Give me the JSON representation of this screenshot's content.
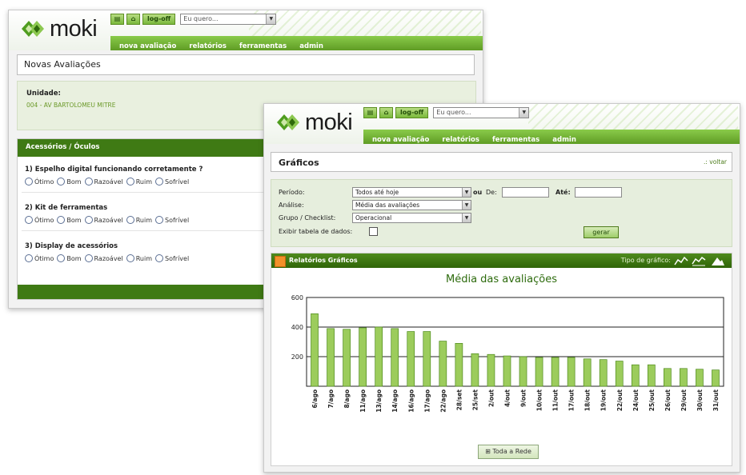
{
  "brand": {
    "logo_text": "moki",
    "green": "#6aa92f",
    "dark_green": "#3f7a14"
  },
  "window1": {
    "toolbar": {
      "logoff_label": "log-off",
      "search_select_value": "Eu quero..."
    },
    "nav": [
      "nova avaliação",
      "relatórios",
      "ferramentas",
      "admin"
    ],
    "page_title": "Novas Avaliações",
    "unit": {
      "label": "Unidade:",
      "value": "004 - AV BARTOLOMEU MITRE"
    },
    "section": {
      "title": "Acessórios / Óculos",
      "questions": [
        {
          "text": "1) Espelho digital funcionando corretamente ?"
        },
        {
          "text": "2) Kit de ferramentas"
        },
        {
          "text": "3) Display de acessórios"
        }
      ],
      "options": [
        "Ótimo",
        "Bom",
        "Razoável",
        "Ruim",
        "Sofrível"
      ]
    }
  },
  "window2": {
    "toolbar": {
      "logoff_label": "log-off",
      "search_select_value": "Eu quero..."
    },
    "nav": [
      "nova avaliação",
      "relatórios",
      "ferramentas",
      "admin"
    ],
    "page_title": "Gráficos",
    "back_link": ".: voltar",
    "filters": {
      "periodo_label": "Período:",
      "periodo_value": "Todos até hoje",
      "ou_label": "ou",
      "de_label": "De:",
      "ate_label": "Até:",
      "analise_label": "Análise:",
      "analise_value": "Média das avaliações",
      "grupo_label": "Grupo / Checklist:",
      "grupo_value": "Operacional",
      "exibir_label": "Exibir tabela de dados:",
      "gerar_label": "gerar"
    },
    "report": {
      "header": "Relatórios Gráficos",
      "chart_type_label": "Tipo de gráfico:",
      "chart_type_icons": [
        "line-chart-icon",
        "area-chart-icon",
        "mountain-chart-icon"
      ],
      "footer_button": "Toda a Rede"
    }
  },
  "chart_data": {
    "type": "bar",
    "title": "Média das avaliações",
    "categories": [
      "6/ago",
      "7/ago",
      "8/ago",
      "11/ago",
      "13/ago",
      "14/ago",
      "16/ago",
      "17/ago",
      "22/ago",
      "28/set",
      "25/set",
      "2/out",
      "4/out",
      "9/out",
      "10/out",
      "11/out",
      "17/out",
      "18/out",
      "19/out",
      "22/out",
      "24/out",
      "25/out",
      "26/out",
      "29/out",
      "30/out",
      "31/out"
    ],
    "values": [
      490,
      390,
      385,
      395,
      400,
      390,
      370,
      370,
      305,
      290,
      220,
      215,
      205,
      200,
      195,
      195,
      195,
      185,
      180,
      170,
      145,
      145,
      120,
      120,
      115,
      110
    ],
    "y_ticks": [
      200,
      400,
      600
    ],
    "ylim": [
      0,
      600
    ],
    "grid": true,
    "bar_color": "#9ccc5c",
    "bar_stroke": "#4e8a1c"
  }
}
